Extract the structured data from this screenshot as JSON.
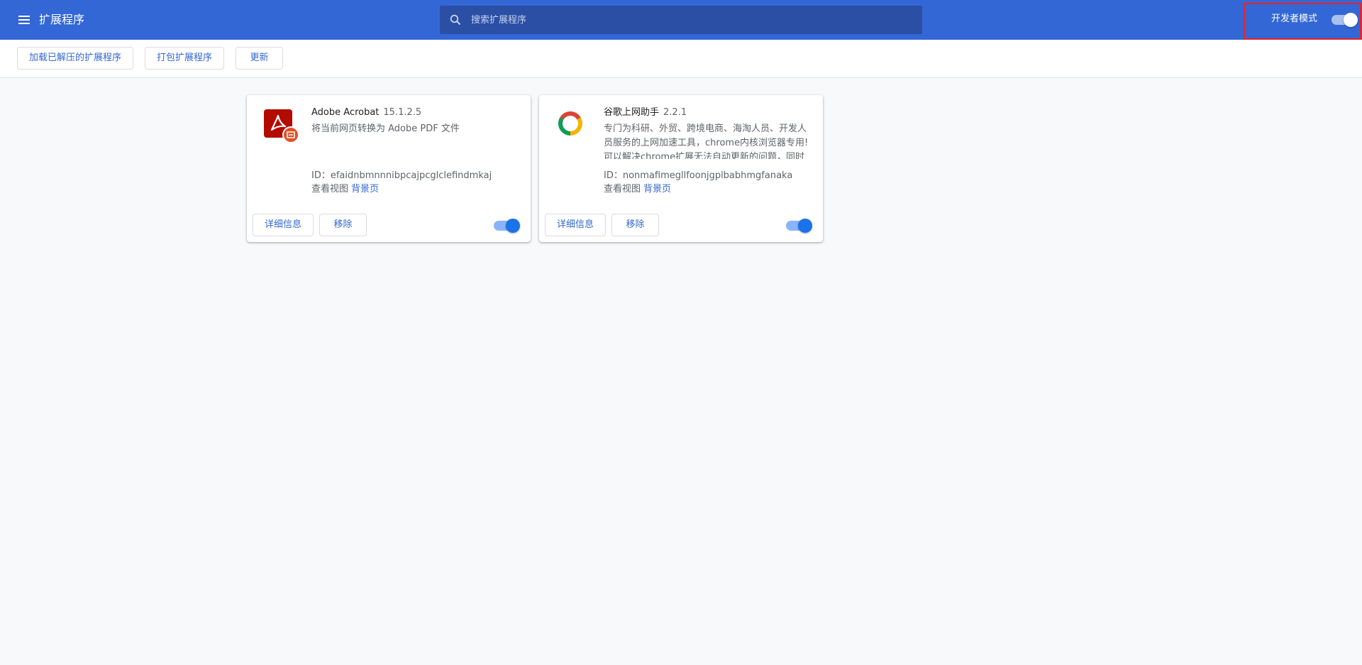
{
  "header": {
    "title": "扩展程序",
    "search_placeholder": "搜索扩展程序",
    "dev_mode_label": "开发者模式",
    "dev_mode_on": true
  },
  "toolbar": {
    "load_unpacked_label": "加载已解压的扩展程序",
    "pack_label": "打包扩展程序",
    "update_label": "更新"
  },
  "extensions": [
    {
      "name": "Adobe Acrobat",
      "version": "15.1.2.5",
      "description": "将当前网页转换为 Adobe PDF 文件",
      "id": "ID：efaidnbmnnnibpcajpcglclefindmkaj",
      "views_label": "查看视图",
      "background_link": "背景页",
      "details_label": "详细信息",
      "remove_label": "移除",
      "enabled": true,
      "icon": "adobe-acrobat-icon"
    },
    {
      "name": "谷歌上网助手",
      "version": "2.2.1",
      "description": "专门为科研、外贸、跨境电商、海淘人员、开发人员服务的上网加速工具，chrome内核浏览器专用!可以解决chrome扩展无法自动更新的问题，同时",
      "id": "ID：nonmafimegllfoonjgplbabhmgfanaka",
      "views_label": "查看视图",
      "background_link": "背景页",
      "details_label": "详细信息",
      "remove_label": "移除",
      "enabled": true,
      "icon": "google-helper-ring-icon"
    }
  ],
  "colors": {
    "header_bg": "#3367d6",
    "search_bg": "#2a4fa5",
    "accent": "#3367d6",
    "highlight_border": "#e8232a",
    "toggle_on": "#1a73e8"
  }
}
